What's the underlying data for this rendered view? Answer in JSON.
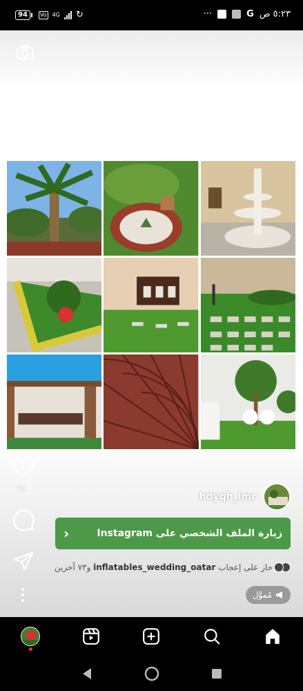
{
  "status_bar": {
    "battery": "94",
    "network": "4G",
    "time": "٥:٢٣ ص",
    "more": "···",
    "carrier_glyph": "G"
  },
  "post": {
    "likes": "٧٤",
    "username": "hdyqh_lmr",
    "visit_button": "زيارة الملف الشخصي على Instagram",
    "liked_prefix": "حاز على إعجاب",
    "liked_user": "inflatables_wedding_oatar",
    "liked_suffix": "و٧٣ آخرين",
    "sponsored": "مُموَّل"
  },
  "colors": {
    "accent_green": "#4c9a48",
    "notification": "#ff3040"
  },
  "icons": [
    "camera-icon",
    "heart-icon",
    "comment-icon",
    "share-icon",
    "more-icon",
    "chevron-right-icon",
    "megaphone-icon",
    "home-icon",
    "search-icon",
    "create-icon",
    "reels-icon",
    "back-icon",
    "home-circle-icon",
    "recents-icon"
  ]
}
